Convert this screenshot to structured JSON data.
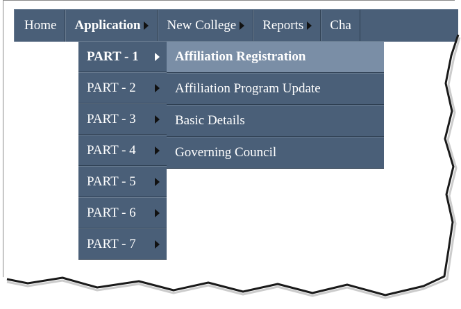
{
  "menubar": {
    "items": [
      {
        "label": "Home"
      },
      {
        "label": "Application"
      },
      {
        "label": "New College"
      },
      {
        "label": "Reports"
      },
      {
        "label": "Cha"
      }
    ]
  },
  "submenu": {
    "items": [
      {
        "label": "PART - 1"
      },
      {
        "label": "PART - 2"
      },
      {
        "label": "PART - 3"
      },
      {
        "label": "PART - 4"
      },
      {
        "label": "PART - 5"
      },
      {
        "label": "PART - 6"
      },
      {
        "label": "PART - 7"
      }
    ]
  },
  "flyout": {
    "items": [
      {
        "label": "Affiliation Registration"
      },
      {
        "label": "Affiliation Program Update"
      },
      {
        "label": "Basic Details"
      },
      {
        "label": "Governing Council"
      }
    ]
  },
  "colors": {
    "menu_bg": "#4a5f78",
    "highlight_bg": "#7a8ea6",
    "text": "#ffffff"
  }
}
